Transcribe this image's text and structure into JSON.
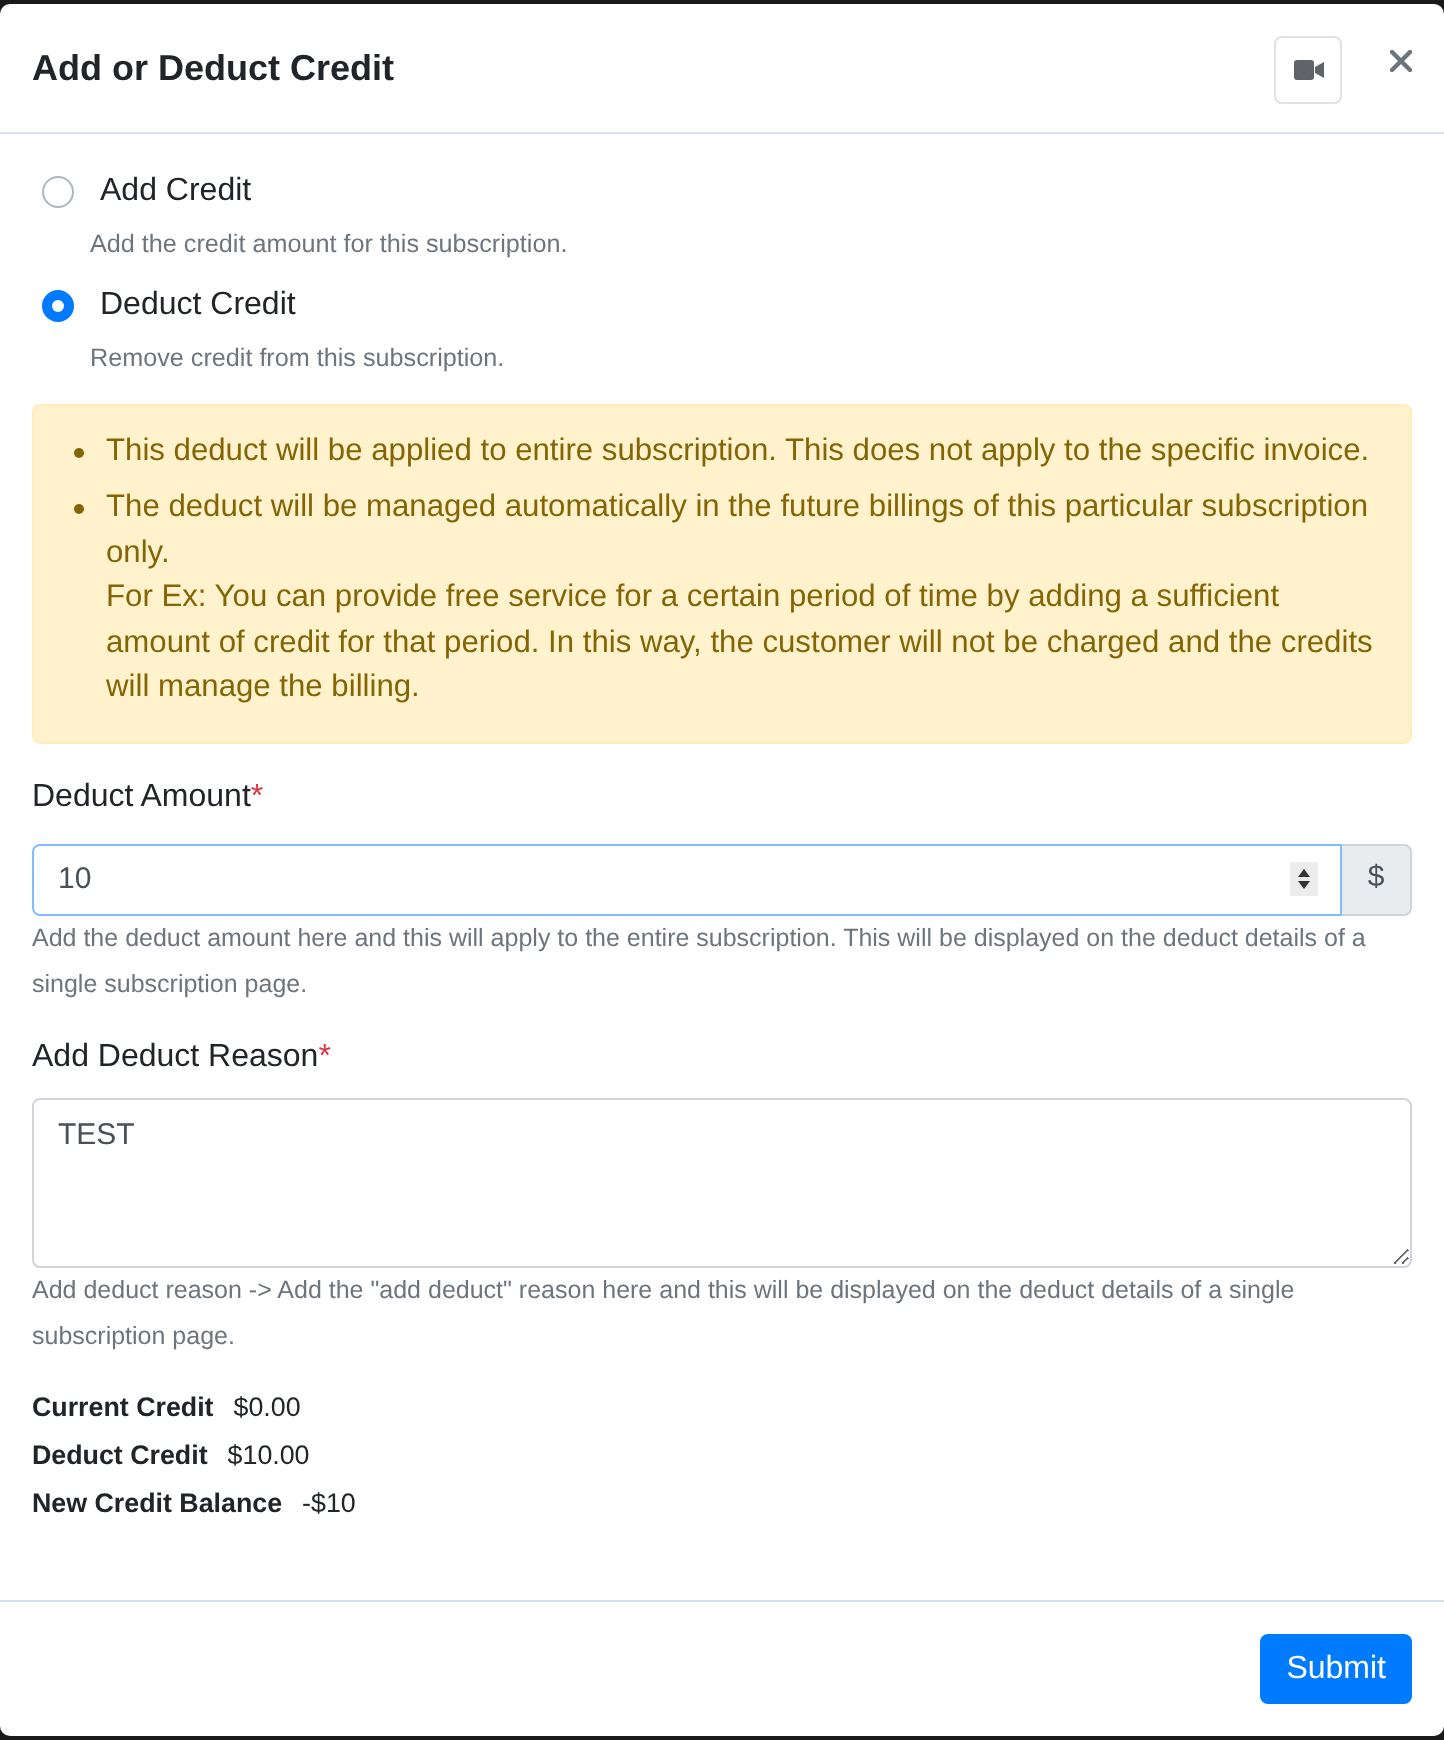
{
  "dialog": {
    "title": "Add or Deduct Credit"
  },
  "options": [
    {
      "label": "Add Credit",
      "hint": "Add the credit amount for this subscription.",
      "selected": false
    },
    {
      "label": "Deduct Credit",
      "hint": "Remove credit from this subscription.",
      "selected": true
    }
  ],
  "notice": {
    "items": [
      {
        "lines": [
          "This deduct will be applied to entire subscription. This does not apply to the specific invoice."
        ]
      },
      {
        "lines": [
          "The deduct will be managed automatically in the future billings of this particular subscription only.",
          "For Ex: You can provide free service for a certain period of time by adding a sufficient amount of credit for that period. In this way, the customer will not be charged and the credits will manage the billing."
        ]
      }
    ]
  },
  "fields": [
    {
      "kind": "number",
      "label": "Deduct Amount",
      "required_mark": "*",
      "value": "10",
      "addon": "$",
      "focused": true,
      "help": "Add the deduct amount here and this will apply to the entire subscription. This will be displayed on the deduct details of a single subscription page."
    },
    {
      "kind": "textarea",
      "label": "Add Deduct Reason",
      "required_mark": "*",
      "value": "TEST",
      "focused": false,
      "help": "Add deduct reason -> Add the \"add deduct\" reason here and this will be displayed on the deduct details of a single subscription page."
    }
  ],
  "summary": [
    {
      "label": "Current Credit",
      "value": "$0.00"
    },
    {
      "label": "Deduct Credit",
      "value": "$10.00"
    },
    {
      "label": "New Credit Balance",
      "value": "-$10"
    }
  ],
  "footer": {
    "submit": "Submit"
  }
}
